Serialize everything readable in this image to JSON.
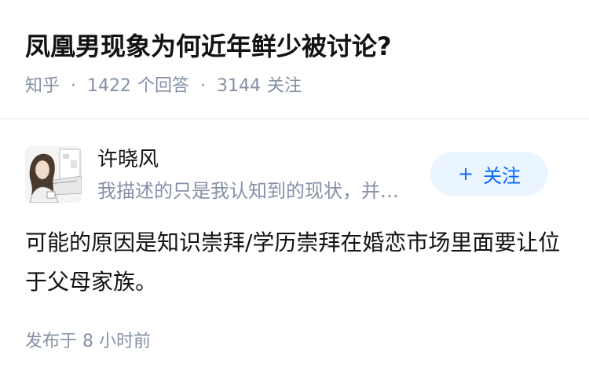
{
  "question": {
    "title": "凤凰男现象为何近年鲜少被讨论?",
    "source": "知乎",
    "separator": "·",
    "answer_count": "1422",
    "answer_label": "个回答",
    "follower_count": "3144",
    "follower_label": "关注"
  },
  "author": {
    "name": "许晓风",
    "bio": "我描述的只是我认知到的现状，并…",
    "follow_plus": "+",
    "follow_label": "关注"
  },
  "answer": {
    "content": "可能的原因是知识崇拜/学历崇拜在婚恋市场里面要让位于父母家族。",
    "time": "发布于 8 小时前"
  },
  "colors": {
    "text_primary": "#121212",
    "text_secondary": "#8590a6",
    "accent": "#0066ff",
    "button_bg": "#ebf5ff"
  }
}
